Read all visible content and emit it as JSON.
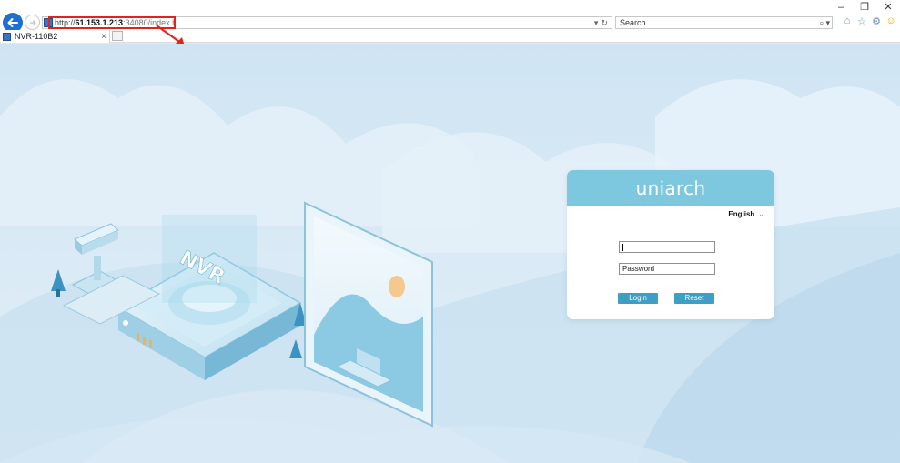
{
  "browser": {
    "url_prefix": "http://",
    "url_host": "61.153.1.213",
    "url_rest": ":34080/index.html",
    "search_placeholder": "Search...",
    "tab_title": "NVR-110B2",
    "tab_close": "×",
    "refresh_glyph": "↻",
    "dropdown_glyph": "▾",
    "search_glyph": "⌕",
    "window_controls": {
      "minimize": "–",
      "restore": "❐",
      "close": "✕"
    },
    "annotation_color": "#e0241b"
  },
  "illustration": {
    "device_label": "NVR"
  },
  "login": {
    "logo": "uniarch",
    "language": "English",
    "username_value": "",
    "password_placeholder": "Password",
    "login_button": "Login",
    "reset_button": "Reset",
    "accent_color": "#7ec8df",
    "button_color": "#3d9fc6"
  },
  "icons": [
    "back-arrow-icon",
    "forward-arrow-icon",
    "refresh-icon",
    "search-icon",
    "home-icon",
    "star-icon",
    "gear-icon",
    "smiley-icon",
    "chevron-down-icon"
  ]
}
